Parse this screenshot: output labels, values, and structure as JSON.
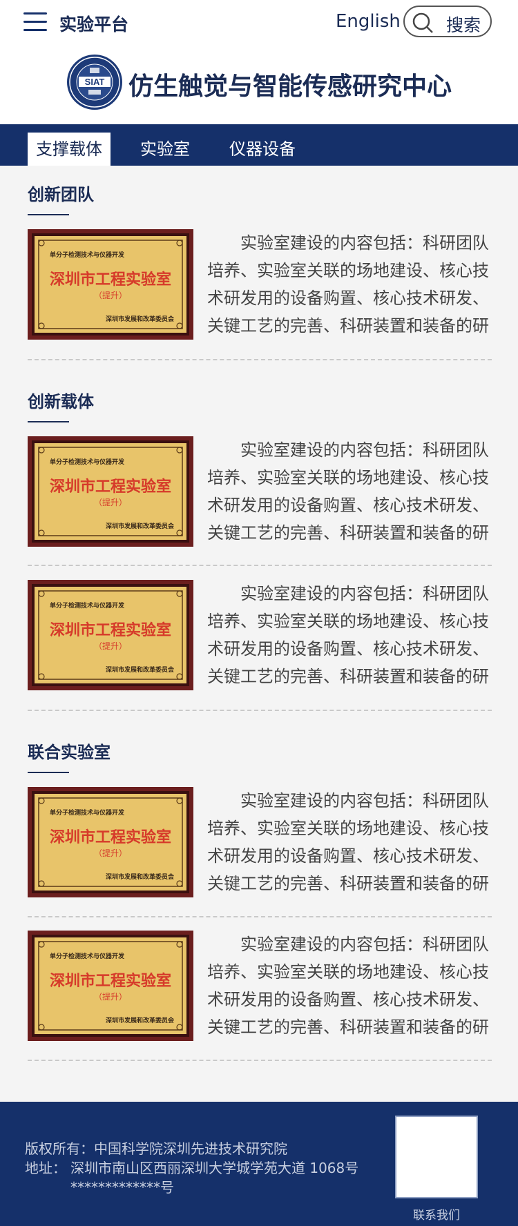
{
  "header": {
    "platform_title": "实验平台",
    "lang_link": "English",
    "search_label": "搜索",
    "logo_text": "SIAT",
    "center_title": "仿生触觉与智能传感研究中心"
  },
  "nav": {
    "tabs": [
      {
        "label": "支撑载体"
      },
      {
        "label": "实验室"
      },
      {
        "label": "仪器设备"
      }
    ]
  },
  "plaque": {
    "top_text": "单分子检测技术与仪器开发",
    "main_text": "深圳市工程实验室",
    "sub_text": "（提升）",
    "issuer_text": "深圳市发展和改革委员会"
  },
  "sections": [
    {
      "title": "创新团队"
    },
    {
      "title": "创新载体"
    },
    {
      "title": "联合实验室"
    }
  ],
  "card_text": "实验室建设的内容包括：科研团队培养、实验室关联的场地建设、核心技术研发用的设备购置、核心技术研发、关键工艺的完善、科研装置和装备的研发",
  "footer": {
    "copyright": "版权所有：中国科学院深圳先进技术研究院",
    "address_label": "地址：",
    "address_line1": "深圳市南山区西丽深圳大学城学苑大道 1068号",
    "address_line2": "*************号",
    "contact": "联系我们"
  },
  "colors": {
    "primary": "#15306a",
    "title": "#1b2c55",
    "plaque_gold": "#e8c46a",
    "plaque_red": "#d63a2a",
    "plaque_frame": "#6b1e1e"
  }
}
